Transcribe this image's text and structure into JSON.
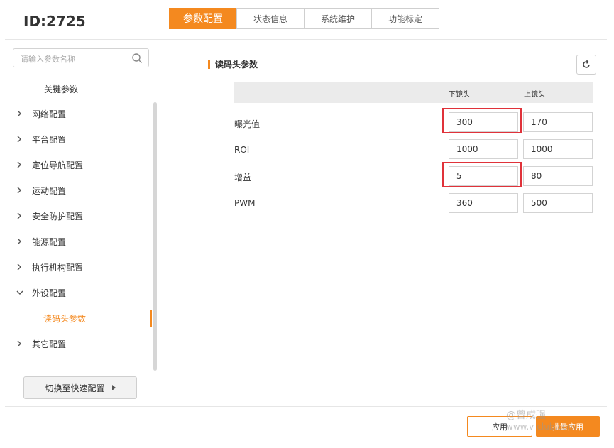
{
  "header": {
    "device_id": "ID:2725",
    "tabs": [
      {
        "label": "参数配置",
        "active": true
      },
      {
        "label": "状态信息",
        "active": false
      },
      {
        "label": "系统维护",
        "active": false
      },
      {
        "label": "功能标定",
        "active": false
      }
    ]
  },
  "sidebar": {
    "search": {
      "placeholder": "请输入参数名称",
      "icon": "search-icon"
    },
    "key_params": "关键参数",
    "items": [
      {
        "label": "网络配置",
        "expanded": false
      },
      {
        "label": "平台配置",
        "expanded": false
      },
      {
        "label": "定位导航配置",
        "expanded": false
      },
      {
        "label": "运动配置",
        "expanded": false
      },
      {
        "label": "安全防护配置",
        "expanded": false
      },
      {
        "label": "能源配置",
        "expanded": false
      },
      {
        "label": "执行机构配置",
        "expanded": false
      },
      {
        "label": "外设配置",
        "expanded": true
      },
      {
        "label": "其它配置",
        "expanded": false
      }
    ],
    "sub_item": "读码头参数",
    "quick_switch": "切换至快速配置"
  },
  "main": {
    "section_title": "读码头参数",
    "refresh_icon": "refresh-icon",
    "columns": [
      "下镜头",
      "上镜头"
    ],
    "rows": [
      {
        "label": "曝光值",
        "lower": "300",
        "upper": "170",
        "lower_highlighted": true
      },
      {
        "label": "ROI",
        "lower": "1000",
        "upper": "1000",
        "lower_highlighted": false
      },
      {
        "label": "增益",
        "lower": "5",
        "upper": "80",
        "lower_highlighted": true
      },
      {
        "label": "PWM",
        "lower": "360",
        "upper": "500",
        "lower_highlighted": false
      }
    ]
  },
  "footer": {
    "apply": "应用",
    "batch_apply": "批量应用",
    "watermark_line1": "@曾成强",
    "watermark_line2": "www.v-club.com"
  },
  "colors": {
    "accent": "#f4891f",
    "highlight": "#e0323a"
  }
}
